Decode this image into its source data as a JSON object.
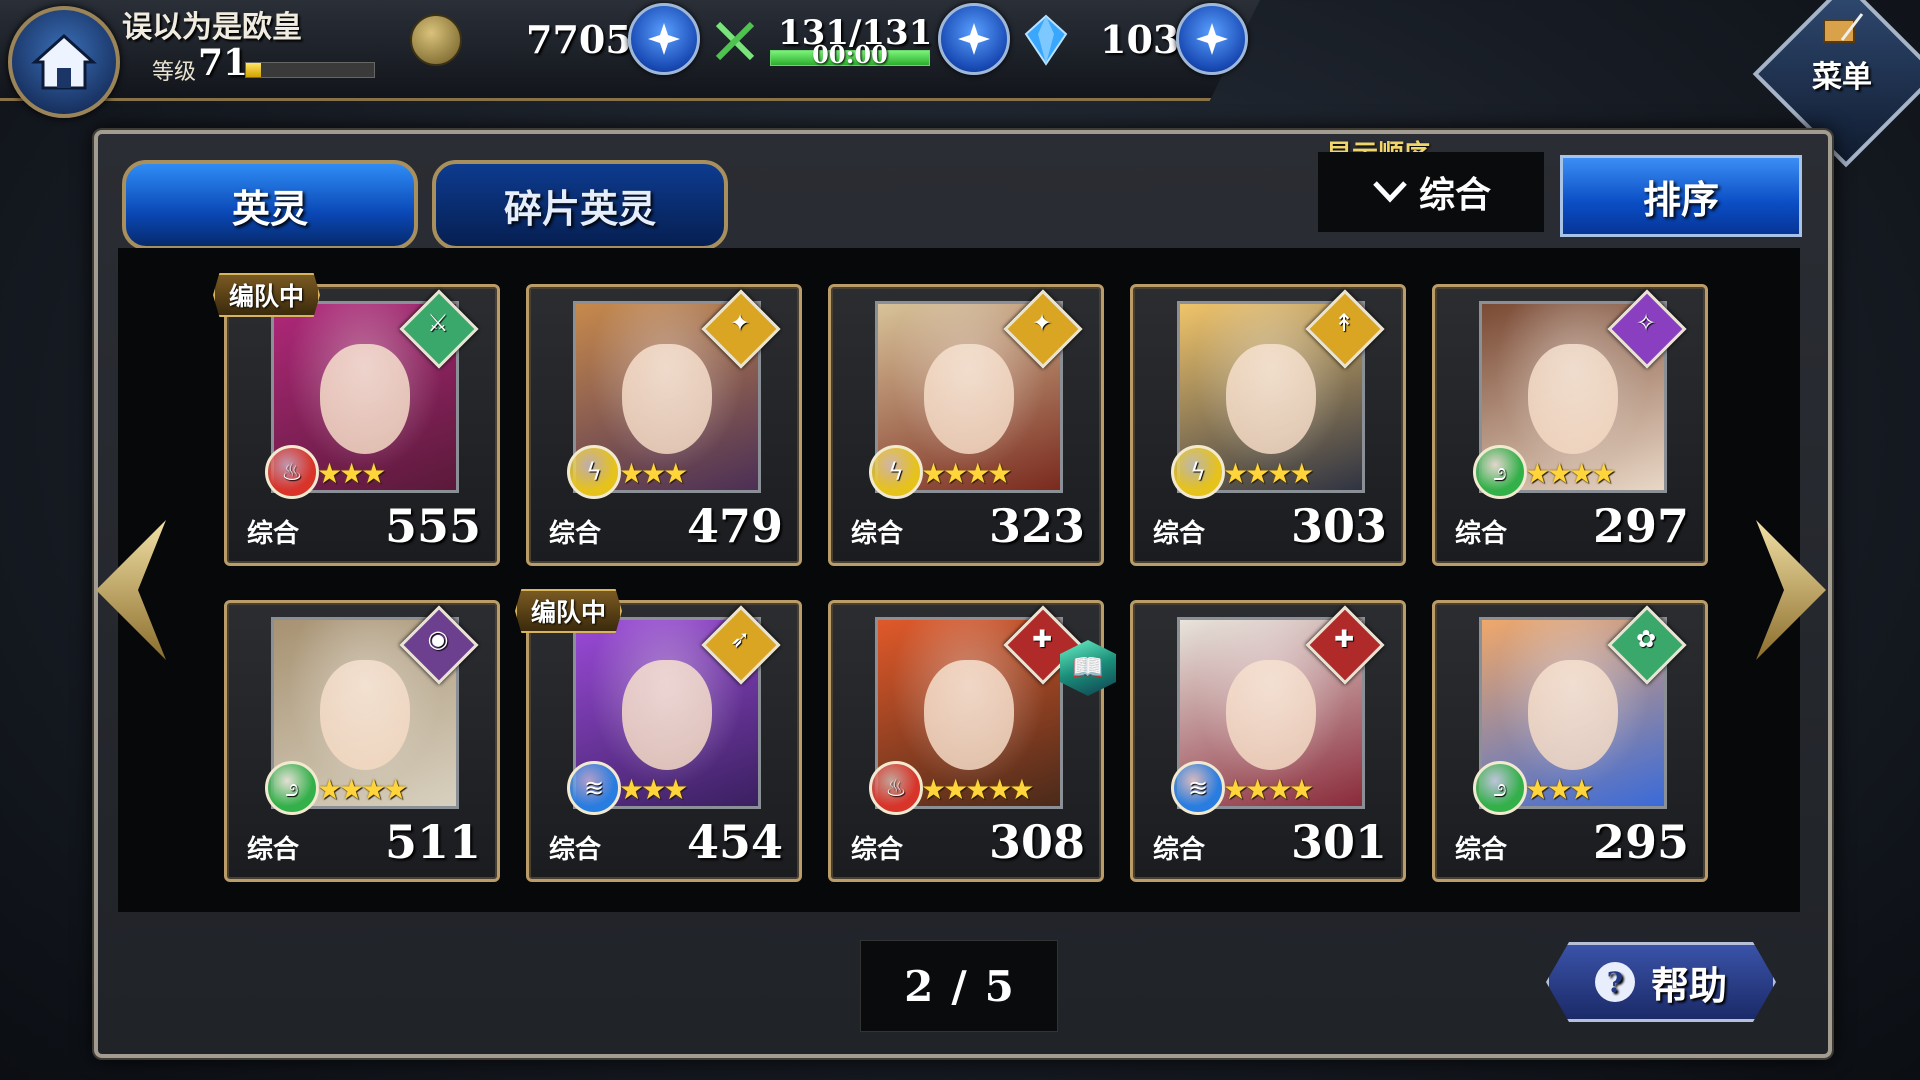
{
  "header": {
    "player_name": "误以为是欧皇",
    "level_label": "等级",
    "level": "71",
    "level_exp_fraction": 0.12,
    "gold": "7705",
    "stamina": "131/131",
    "stamina_fraction": 1.0,
    "stamina_timer": "00:00",
    "crystals": "103",
    "menu_label": "菜单"
  },
  "tabs": [
    {
      "label": "英灵",
      "active": true
    },
    {
      "label": "碎片英灵",
      "active": false
    }
  ],
  "sort": {
    "order_label": "显示顺序",
    "selected": "综合",
    "button_label": "排序"
  },
  "cards": [
    {
      "stat_label": "综合",
      "value": "555",
      "stars": 3,
      "in_party": true,
      "party_label": "编队中",
      "element": "fire",
      "element_color": "#d8342a",
      "class": "sword",
      "class_color": "#3aa76b",
      "portrait_colors": [
        "#b0287a",
        "#5a1a3a"
      ]
    },
    {
      "stat_label": "综合",
      "value": "479",
      "stars": 3,
      "in_party": false,
      "element": "thunder",
      "element_color": "#e6c21c",
      "class": "gun",
      "class_color": "#d9a522",
      "portrait_colors": [
        "#c78a4c",
        "#4b2f55"
      ]
    },
    {
      "stat_label": "综合",
      "value": "323",
      "stars": 4,
      "in_party": false,
      "element": "thunder",
      "element_color": "#e6c21c",
      "class": "gun",
      "class_color": "#d9a522",
      "portrait_colors": [
        "#d8c39a",
        "#7a2a1e"
      ]
    },
    {
      "stat_label": "综合",
      "value": "303",
      "stars": 4,
      "in_party": false,
      "element": "thunder",
      "element_color": "#e6c21c",
      "class": "lance",
      "class_color": "#d9a522",
      "portrait_colors": [
        "#f0c46a",
        "#2f3342"
      ]
    },
    {
      "stat_label": "综合",
      "value": "297",
      "stars": 4,
      "in_party": false,
      "element": "wind",
      "element_color": "#34b04a",
      "class": "magic",
      "class_color": "#8a3fc0",
      "portrait_colors": [
        "#7a4a34",
        "#e9d7c6"
      ]
    },
    {
      "stat_label": "综合",
      "value": "511",
      "stars": 4,
      "in_party": false,
      "element": "wind",
      "element_color": "#34b04a",
      "class": "eye",
      "class_color": "#6d3f8f",
      "portrait_colors": [
        "#a79272",
        "#d8d0bf"
      ]
    },
    {
      "stat_label": "综合",
      "value": "454",
      "stars": 3,
      "in_party": true,
      "party_label": "编队中",
      "element": "water",
      "element_color": "#2a7de0",
      "class": "bow",
      "class_color": "#d9a522",
      "portrait_colors": [
        "#9b4ad8",
        "#3a2060"
      ]
    },
    {
      "stat_label": "综合",
      "value": "308",
      "stars": 5,
      "in_party": false,
      "element": "fire",
      "element_color": "#d8342a",
      "class": "heal",
      "class_color": "#b02a2a",
      "portrait_colors": [
        "#e0592a",
        "#4a2a1a"
      ],
      "has_book": true
    },
    {
      "stat_label": "综合",
      "value": "301",
      "stars": 4,
      "in_party": false,
      "element": "water",
      "element_color": "#2a7de0",
      "class": "heal",
      "class_color": "#b02a2a",
      "portrait_colors": [
        "#e8e4dc",
        "#8a2a3a"
      ]
    },
    {
      "stat_label": "综合",
      "value": "295",
      "stars": 3,
      "in_party": false,
      "element": "wind",
      "element_color": "#34b04a",
      "class": "staff",
      "class_color": "#3aa76b",
      "portrait_colors": [
        "#f0a86a",
        "#3a6ad8"
      ]
    }
  ],
  "pager": {
    "current": "2",
    "separator": "/",
    "total": "5"
  },
  "help": {
    "label": "帮助",
    "icon_text": "?"
  },
  "icons": {
    "home": "home-icon",
    "gold": "coin-icon",
    "stamina": "crossed-swords-icon",
    "crystal": "crystal-icon",
    "plus": "plus-icon",
    "menu": "book-quill-icon",
    "dropdown": "chevron-down-icon",
    "prev": "arrow-left-icon",
    "next": "arrow-right-icon"
  }
}
